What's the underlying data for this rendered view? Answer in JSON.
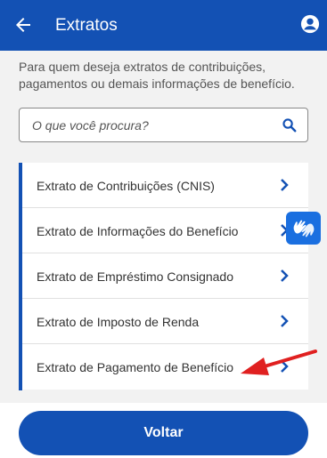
{
  "header": {
    "title": "Extratos",
    "back_icon": "arrow-left-icon",
    "account_icon": "user-circle-icon",
    "color": "#1351b4"
  },
  "intro_text": "Para quem deseja extratos de contribuições, pagamentos ou demais informações de benefício.",
  "search": {
    "placeholder": "O que você procura?",
    "value": "",
    "icon": "search-icon"
  },
  "statements": {
    "items": [
      {
        "label": "Extrato de Contribuições (CNIS)"
      },
      {
        "label": "Extrato de Informações do Benefício"
      },
      {
        "label": "Extrato de Empréstimo Consignado"
      },
      {
        "label": "Extrato de Imposto de Renda"
      },
      {
        "label": "Extrato de Pagamento de Benefício"
      }
    ],
    "chevron_icon": "chevron-right-icon"
  },
  "accessibility": {
    "icon": "sign-language-hands-icon"
  },
  "annotation": {
    "icon": "red-arrow-pointer-icon",
    "color": "#e02020"
  },
  "footer": {
    "voltar_label": "Voltar"
  }
}
